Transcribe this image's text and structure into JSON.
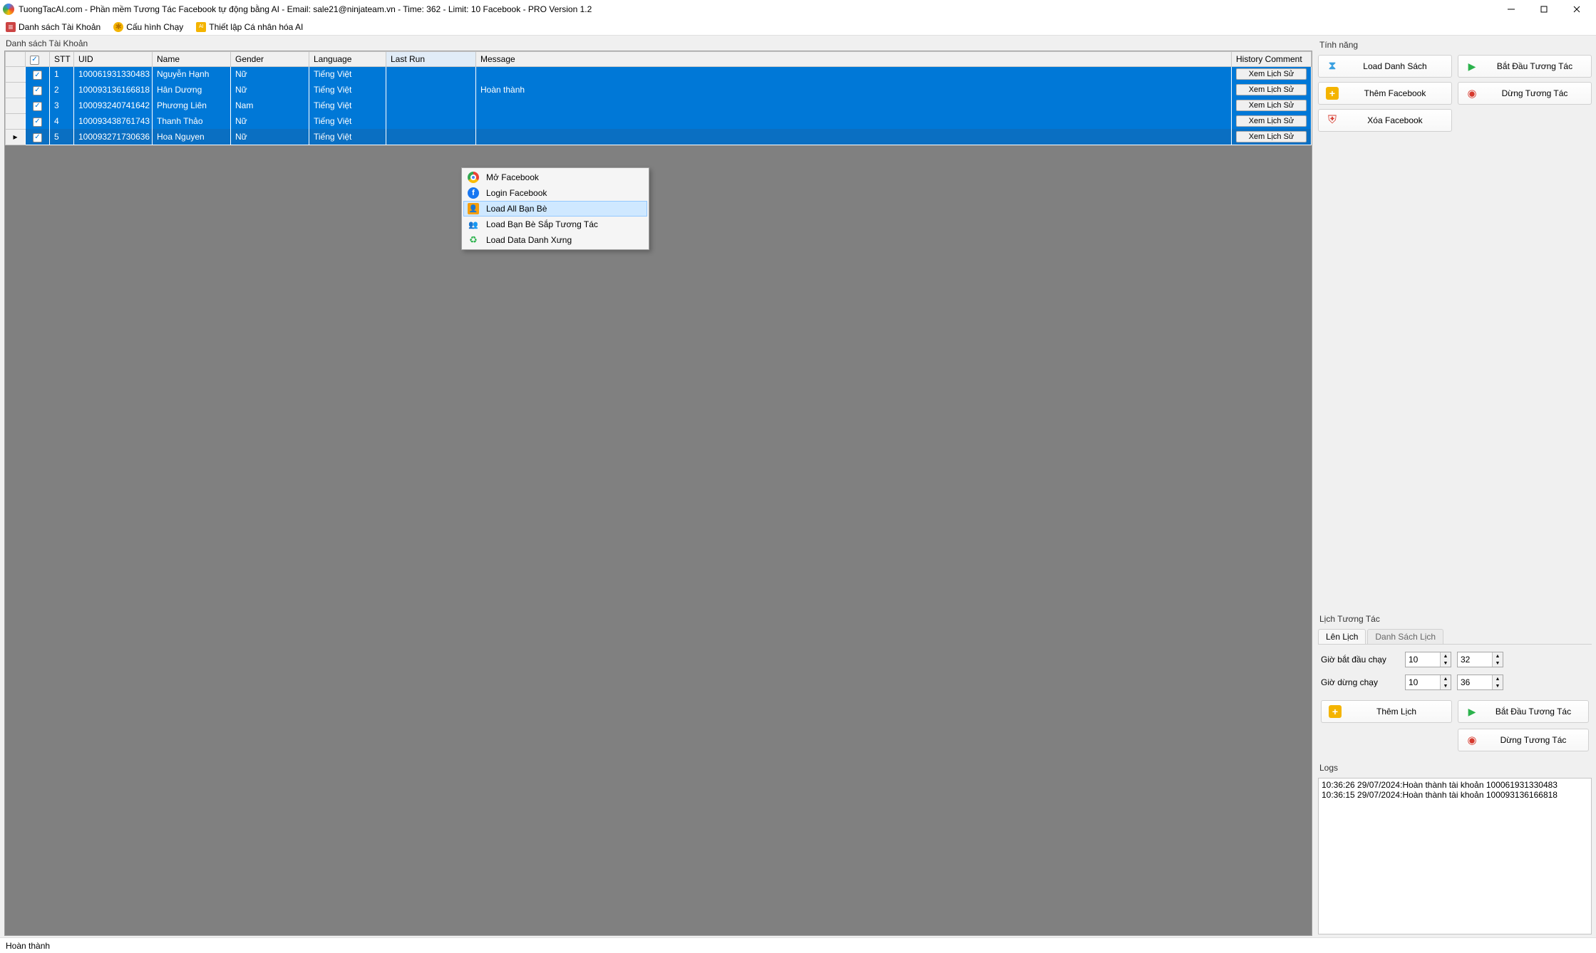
{
  "title": "TuongTacAI.com - Phần mềm Tương Tác Facebook tự động bằng AI - Email: sale21@ninjateam.vn - Time: 362 - Limit: 10 Facebook - PRO Version 1.2",
  "toolbar": {
    "accounts": "Danh sách Tài Khoản",
    "runConfig": "Cấu hình Chạy",
    "aiPersonal": "Thiết lập Cá nhân hóa AI"
  },
  "leftSectionLabel": "Danh sách Tài Khoản",
  "columns": {
    "stt": "STT",
    "uid": "UID",
    "name": "Name",
    "gender": "Gender",
    "language": "Language",
    "lastRun": "Last Run",
    "message": "Message",
    "history": "History Comment"
  },
  "historyButtonLabel": "Xem Lịch Sử",
  "rows": [
    {
      "stt": "1",
      "uid": "100061931330483",
      "name": "Nguyễn Hạnh",
      "gender": "Nữ",
      "language": "Tiếng Việt",
      "lastRun": "",
      "message": ""
    },
    {
      "stt": "2",
      "uid": "100093136166818",
      "name": "Hân Dương",
      "gender": "Nữ",
      "language": "Tiếng Việt",
      "lastRun": "",
      "message": "Hoàn thành"
    },
    {
      "stt": "3",
      "uid": "100093240741642",
      "name": "Phương Liên",
      "gender": "Nam",
      "language": "Tiếng Việt",
      "lastRun": "",
      "message": ""
    },
    {
      "stt": "4",
      "uid": "100093438761743",
      "name": "Thanh Thảo",
      "gender": "Nữ",
      "language": "Tiếng Việt",
      "lastRun": "",
      "message": ""
    },
    {
      "stt": "5",
      "uid": "100093271730636",
      "name": "Hoa Nguyen",
      "gender": "Nữ",
      "language": "Tiếng Việt",
      "lastRun": "",
      "message": ""
    }
  ],
  "contextMenu": {
    "openFb": "Mở Facebook",
    "loginFb": "Login Facebook",
    "loadAllFriends": "Load All Bạn Bè",
    "loadSoonFriends": "Load Bạn Bè Sắp Tương Tác",
    "loadPronounData": "Load Data Danh Xưng"
  },
  "features": {
    "label": "Tính năng",
    "loadList": "Load Danh Sách",
    "addFb": "Thêm Facebook",
    "deleteFb": "Xóa Facebook",
    "start": "Bắt Đầu Tương Tác",
    "stop": "Dừng Tương Tác"
  },
  "schedule": {
    "label": "Lịch Tương Tác",
    "tabSchedule": "Lên Lịch",
    "tabList": "Danh Sách Lịch",
    "startTimeLabel": "Giờ bắt đầu chạy",
    "stopTimeLabel": "Giờ dừng chạy",
    "startHour": "10",
    "startMinute": "32",
    "stopHour": "10",
    "stopMinute": "36",
    "addSchedule": "Thêm Lịch",
    "start": "Bắt Đầu Tương Tác",
    "stop": "Dừng Tương Tác"
  },
  "logs": {
    "label": "Logs",
    "lines": [
      "10:36:26 29/07/2024:Hoàn thành tài khoản 100061931330483",
      "10:36:15 29/07/2024:Hoàn thành tài khoản 100093136166818"
    ]
  },
  "statusText": "Hoàn thành"
}
